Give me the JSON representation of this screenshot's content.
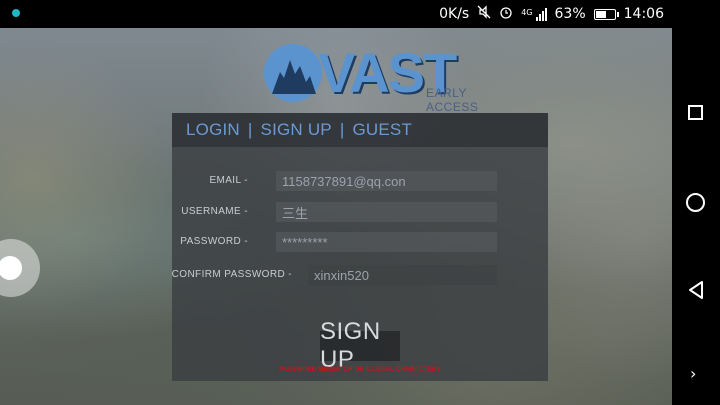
{
  "status_bar": {
    "net_speed": "0K/s",
    "network": "4G",
    "battery": "63%",
    "battery_level": 0.63,
    "time": "14:06"
  },
  "logo": {
    "name": "VAST",
    "subtitle": "EARLY ACCESS",
    "color": "#5b93cf"
  },
  "tabs": [
    {
      "label": "LOGIN"
    },
    {
      "label": "SIGN UP"
    },
    {
      "label": "GUEST"
    }
  ],
  "form": {
    "email": {
      "label": "EMAIL -",
      "value": "1158737891@qq.con"
    },
    "username": {
      "label": "USERNAME -",
      "value": "三生"
    },
    "password": {
      "label": "PASSWORD -",
      "value": "*********"
    },
    "confirm_password": {
      "label": "CONFIRM PASSWORD -",
      "value": "xinxin520"
    }
  },
  "signup_button": "SIGN UP",
  "error_message": "PASSWORD MISMATCH OR ILLEGAL CHARACTERS",
  "error_color": "#c21a1a",
  "nav": {
    "icons": [
      "recents-icon",
      "home-icon",
      "back-icon",
      "expand-chevron-icon"
    ]
  }
}
